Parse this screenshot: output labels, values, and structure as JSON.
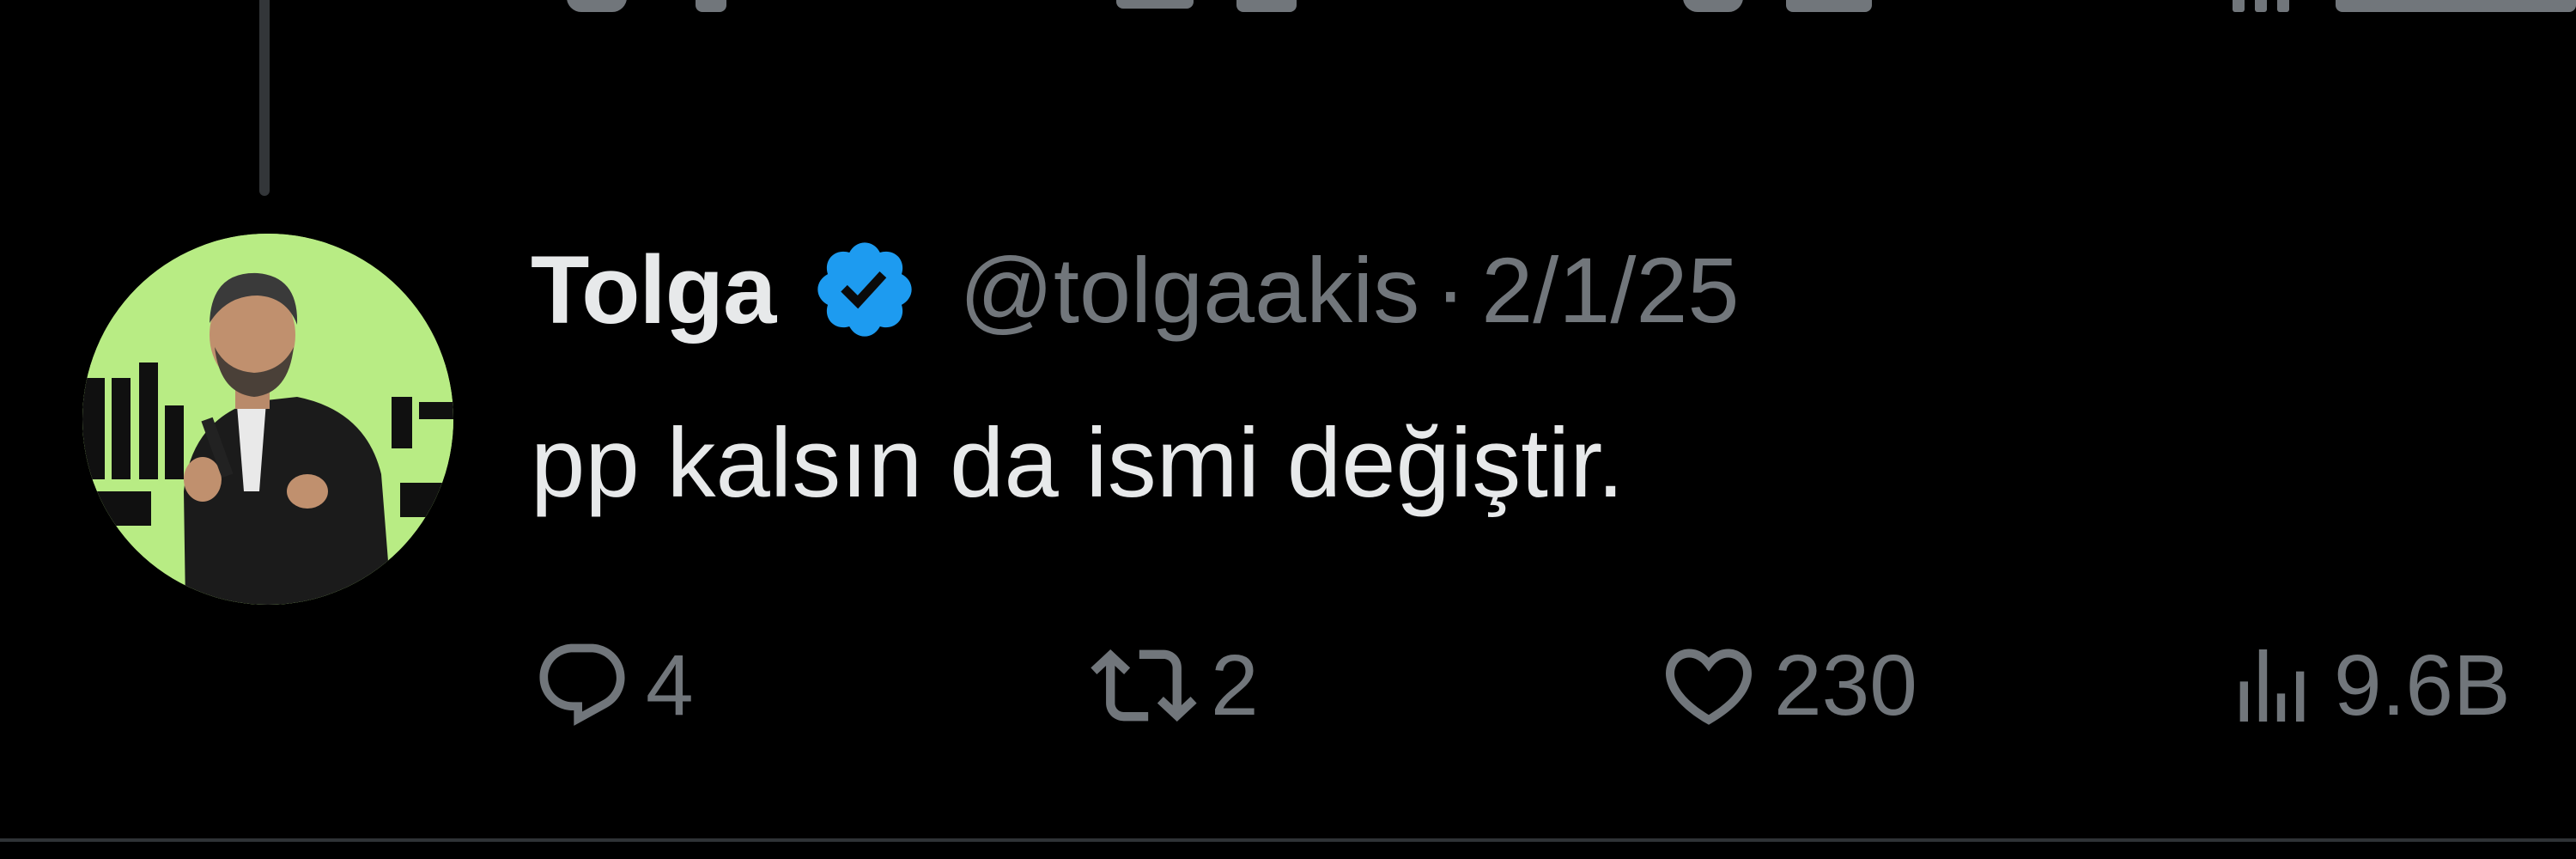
{
  "tweet": {
    "display_name": "Tolga",
    "verified": true,
    "handle": "@tolgaakis",
    "separator": "·",
    "date": "2/1/25",
    "text": "pp kalsın da ismi değiştir."
  },
  "actions": {
    "replies": "4",
    "retweets": "2",
    "likes": "230",
    "views": "9.6B"
  },
  "icons": {
    "reply": "reply-icon",
    "retweet": "retweet-icon",
    "like": "heart-icon",
    "views": "views-icon",
    "verified": "verified-badge-icon"
  },
  "colors": {
    "background": "#000000",
    "text_primary": "#e7e9ea",
    "text_secondary": "#71767b",
    "verified_blue": "#1d9bf0",
    "avatar_background": "#b8ec84"
  }
}
